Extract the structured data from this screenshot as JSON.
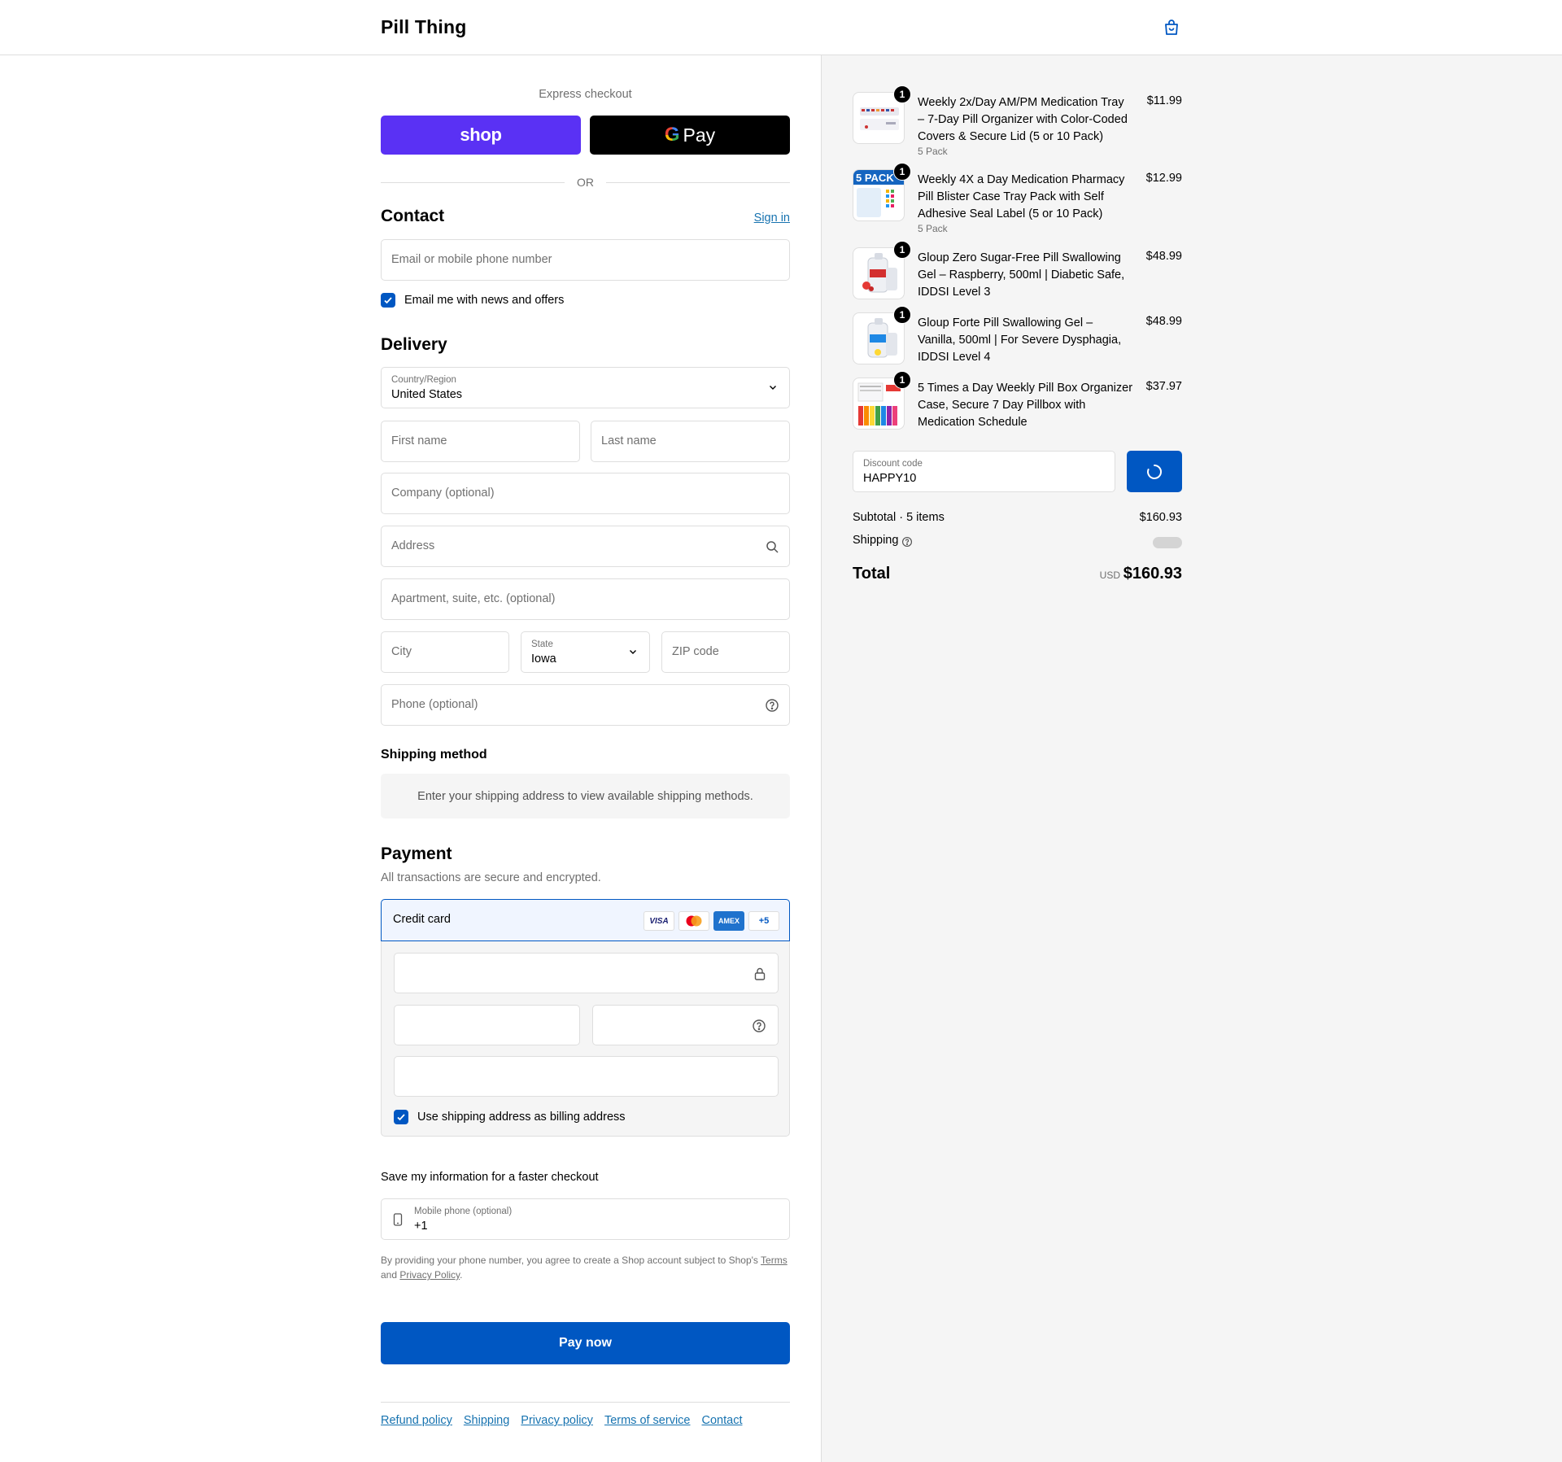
{
  "header": {
    "brand": "Pill Thing",
    "cart_icon": "shopping-bag-icon"
  },
  "express": {
    "title": "Express checkout",
    "shop_label": "shop",
    "gpay_g": "G",
    "gpay_label": "Pay",
    "or": "OR"
  },
  "contact": {
    "title": "Contact",
    "sign_in": "Sign in",
    "email_placeholder": "Email or mobile phone number",
    "newsletter_label": "Email me with news and offers",
    "newsletter_checked": true
  },
  "delivery": {
    "title": "Delivery",
    "country_label": "Country/Region",
    "country_value": "United States",
    "first_name": "First name",
    "last_name": "Last name",
    "company": "Company (optional)",
    "address": "Address",
    "apartment": "Apartment, suite, etc. (optional)",
    "city": "City",
    "state_label": "State",
    "state_value": "Iowa",
    "zip": "ZIP code",
    "phone": "Phone (optional)"
  },
  "shipping_method": {
    "title": "Shipping method",
    "note": "Enter your shipping address to view available shipping methods."
  },
  "payment": {
    "title": "Payment",
    "description": "All transactions are secure and encrypted.",
    "method": "Credit card",
    "cards": [
      "VISA",
      "MC",
      "AMEX",
      "+5"
    ],
    "billing_label": "Use shipping address as billing address",
    "billing_checked": true
  },
  "save_info": {
    "title": "Save my information for a faster checkout",
    "phone_label": "Mobile phone (optional)",
    "phone_value": "+1",
    "legal_prefix": "By providing your phone number, you agree to create a Shop account subject to Shop's",
    "legal_terms": "Terms",
    "legal_and": "and",
    "legal_privacy": "Privacy Policy",
    "legal_suffix": "."
  },
  "pay_button": "Pay now",
  "footer_links": [
    "Refund policy",
    "Shipping",
    "Privacy policy",
    "Terms of service",
    "Contact"
  ],
  "cart": {
    "items": [
      {
        "title": "Weekly 2x/Day AM/PM Medication Tray – 7-Day Pill Organizer with Color-Coded Covers & Secure Lid (5 or 10 Pack)",
        "variant": "5 Pack",
        "price": "$11.99",
        "qty": "1"
      },
      {
        "title": "Weekly 4X a Day Medication Pharmacy Pill Blister Case Tray Pack with Self Adhesive Seal Label (5 or 10 Pack)",
        "variant": "5 Pack",
        "price": "$12.99",
        "qty": "1",
        "thumb_text": "5 PACK"
      },
      {
        "title": "Gloup Zero Sugar-Free Pill Swallowing Gel – Raspberry, 500ml | Diabetic Safe, IDDSI Level 3",
        "variant": "",
        "price": "$48.99",
        "qty": "1"
      },
      {
        "title": "Gloup Forte Pill Swallowing Gel – Vanilla, 500ml | For Severe Dysphagia, IDDSI Level 4",
        "variant": "",
        "price": "$48.99",
        "qty": "1"
      },
      {
        "title": "5 Times a Day Weekly Pill Box Organizer Case, Secure 7 Day Pillbox with Medication Schedule",
        "variant": "",
        "price": "$37.97",
        "qty": "1"
      }
    ],
    "discount_label": "Discount code",
    "discount_value": "HAPPY10",
    "subtotal_label": "Subtotal · 5 items",
    "subtotal_value": "$160.93",
    "shipping_label": "Shipping",
    "total_label": "Total",
    "currency": "USD",
    "total_value": "$160.93"
  }
}
